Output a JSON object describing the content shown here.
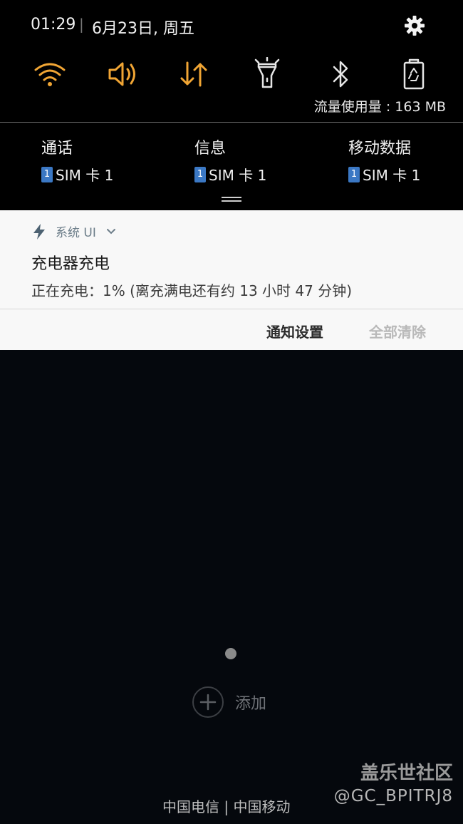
{
  "status": {
    "time": "01:29",
    "separator": "|",
    "date": "6月23日, 周五"
  },
  "quick_panel": {
    "toggles": [
      {
        "icon": "wifi-icon",
        "active": true
      },
      {
        "icon": "sound-icon",
        "active": true
      },
      {
        "icon": "mobile-data-icon",
        "active": true
      },
      {
        "icon": "flashlight-icon",
        "active": false
      },
      {
        "icon": "bluetooth-icon",
        "active": false
      },
      {
        "icon": "power-saving-icon",
        "active": false
      }
    ],
    "data_usage": "流量使用量 : 163 MB",
    "accent_color": "#f0a534"
  },
  "sim_prefs": [
    {
      "title": "通话",
      "badge": "1",
      "sim": "SIM 卡 1"
    },
    {
      "title": "信息",
      "badge": "1",
      "sim": "SIM 卡 1"
    },
    {
      "title": "移动数据",
      "badge": "1",
      "sim": "SIM 卡 1"
    }
  ],
  "notification": {
    "app_name": "系统 UI",
    "title": "充电器充电",
    "text": "正在充电：1% (离充满电还有约 13 小时 47 分钟)",
    "settings_label": "通知设置",
    "clear_label": "全部清除"
  },
  "home": {
    "add_label": "添加"
  },
  "footer": {
    "carriers": "中国电信 | 中国移动"
  },
  "watermark": {
    "title": "盖乐世社区",
    "user": "@GC_BPITRJ8"
  }
}
